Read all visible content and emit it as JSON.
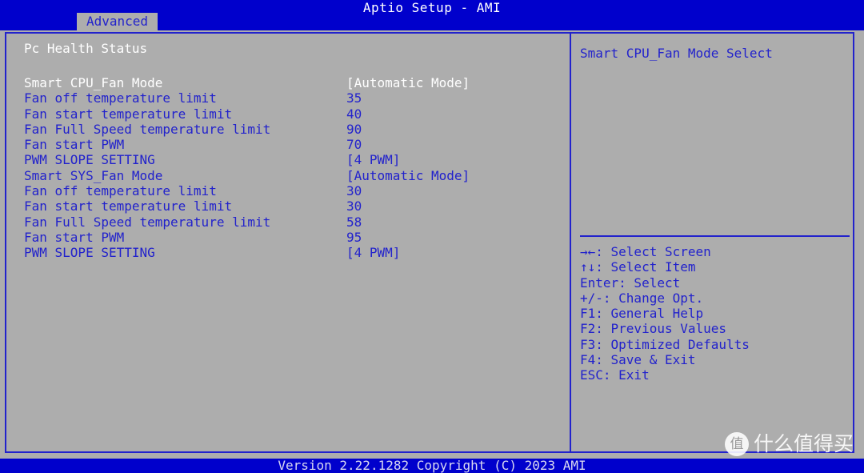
{
  "colors": {
    "background": "#adadad",
    "accent_blue": "#2222cc",
    "titlebar_blue": "#0000cc",
    "selected_text": "#ffffff"
  },
  "titlebar": {
    "title": "Aptio Setup - AMI",
    "tabs": [
      {
        "label": "Advanced",
        "active": true
      }
    ]
  },
  "main": {
    "section_heading": "Pc Health Status",
    "settings": [
      {
        "label": "Smart CPU_Fan Mode",
        "value": "[Automatic Mode]",
        "selected": true
      },
      {
        "label": "Fan off temperature limit",
        "value": "35",
        "selected": false
      },
      {
        "label": "Fan start temperature limit",
        "value": "40",
        "selected": false
      },
      {
        "label": "Fan Full Speed temperature limit",
        "value": "90",
        "selected": false
      },
      {
        "label": "Fan start PWM",
        "value": "70",
        "selected": false
      },
      {
        "label": "PWM SLOPE SETTING",
        "value": "[4 PWM]",
        "selected": false
      },
      {
        "label": "Smart SYS_Fan Mode",
        "value": "[Automatic Mode]",
        "selected": false
      },
      {
        "label": "Fan off temperature limit",
        "value": "30",
        "selected": false
      },
      {
        "label": "Fan start temperature limit",
        "value": "30",
        "selected": false
      },
      {
        "label": "Fan Full Speed temperature limit",
        "value": "58",
        "selected": false
      },
      {
        "label": "Fan start PWM",
        "value": "95",
        "selected": false
      },
      {
        "label": "PWM SLOPE SETTING",
        "value": "[4 PWM]",
        "selected": false
      }
    ]
  },
  "help_panel": {
    "description": "Smart CPU_Fan Mode Select",
    "keys": [
      "→←: Select Screen",
      "↑↓: Select Item",
      "Enter: Select",
      "+/-: Change Opt.",
      "F1: General Help",
      "F2: Previous Values",
      "F3: Optimized Defaults",
      "F4: Save & Exit",
      "ESC: Exit"
    ]
  },
  "footer": {
    "version_text": "Version 2.22.1282 Copyright (C) 2023 AMI"
  },
  "watermark": {
    "badge": "值",
    "text": "什么值得买"
  }
}
